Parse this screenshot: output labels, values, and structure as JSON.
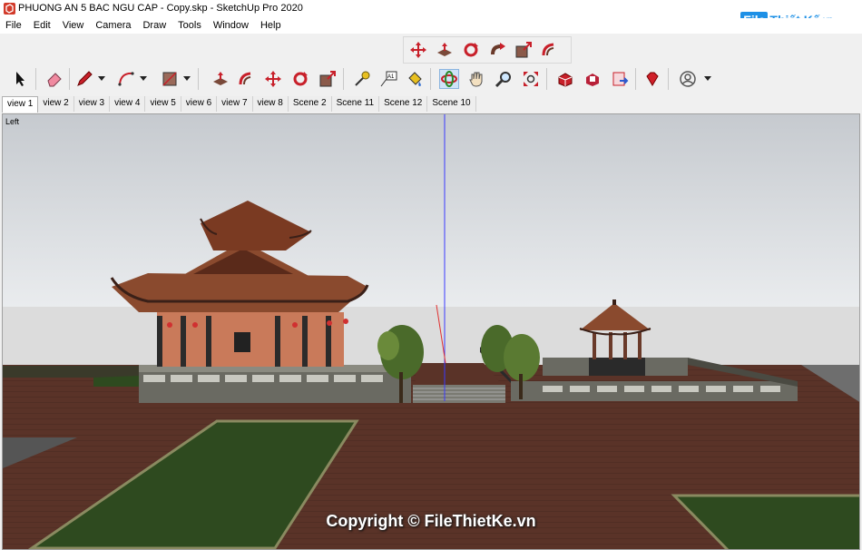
{
  "window": {
    "title": "PHUONG AN 5 BAC NGU CAP - Copy.skp - SketchUp Pro 2020",
    "app_icon": "sketchup-logo-icon"
  },
  "watermark": {
    "logo_box": "File",
    "logo_text": "Thiết Kế",
    "logo_tld": ".vn"
  },
  "menu": [
    "File",
    "Edit",
    "View",
    "Camera",
    "Draw",
    "Tools",
    "Window",
    "Help"
  ],
  "scene_tabs": [
    "view 1",
    "view 2",
    "view 3",
    "view 4",
    "view 5",
    "view 6",
    "view 7",
    "view 8",
    "Scene 2",
    "Scene 11",
    "Scene 12",
    "Scene 10"
  ],
  "active_scene": "view 1",
  "viewport": {
    "view_label": "Left",
    "copyright": "Copyright © FileThietKe.vn"
  },
  "colors": {
    "ground": "#5b342a",
    "grass": "#2e4a1f",
    "sky_top": "#c9cdd1",
    "sky_bottom": "#eef0f2",
    "roof": "#8a4a2e",
    "axis_blue": "#3a3aff",
    "axis_red": "#e03030"
  }
}
